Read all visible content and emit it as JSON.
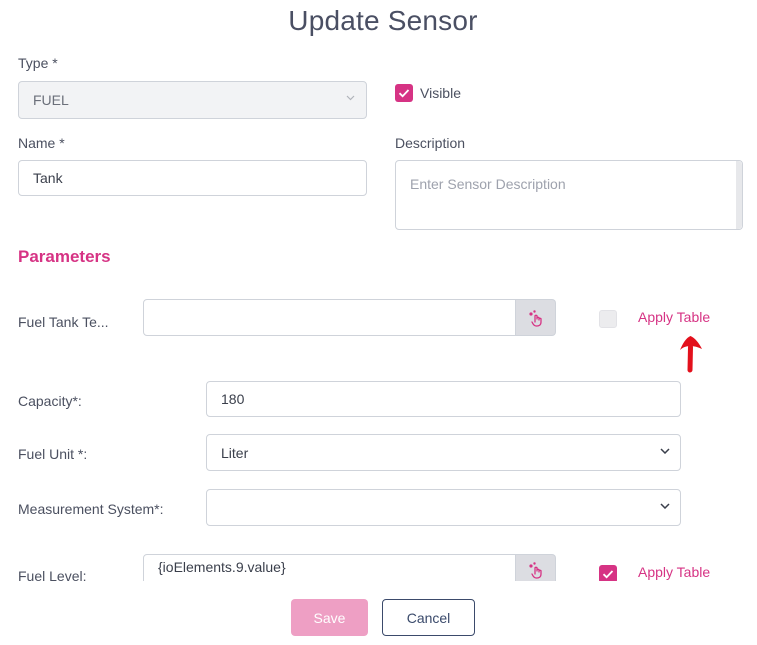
{
  "title": "Update Sensor",
  "type": {
    "label": "Type *",
    "value": "FUEL"
  },
  "visible": {
    "label": "Visible",
    "checked": true
  },
  "name": {
    "label": "Name *",
    "value": "Tank"
  },
  "description": {
    "label": "Description",
    "placeholder": "Enter Sensor Description"
  },
  "parameters": {
    "heading": "Parameters",
    "fuel_tank": {
      "label": "Fuel Tank Te...",
      "value": "",
      "apply_table_label": "Apply Table",
      "apply_table_checked": false
    },
    "capacity": {
      "label": "Capacity*:",
      "value": "180"
    },
    "fuel_unit": {
      "label": "Fuel Unit *:",
      "value": "Liter"
    },
    "measurement_system": {
      "label": "Measurement System*:",
      "value": ""
    },
    "fuel_level": {
      "label": "Fuel Level:",
      "value": "{ioElements.9.value}",
      "apply_table_label": "Apply Table",
      "apply_table_checked": true
    }
  },
  "buttons": {
    "save": "Save",
    "cancel": "Cancel"
  },
  "colors": {
    "accent": "#d63384",
    "annotation_arrow": "#e3101c"
  },
  "icons": {
    "picker": "pointer-hand-icon",
    "annotation": "red-arrow-icon"
  }
}
